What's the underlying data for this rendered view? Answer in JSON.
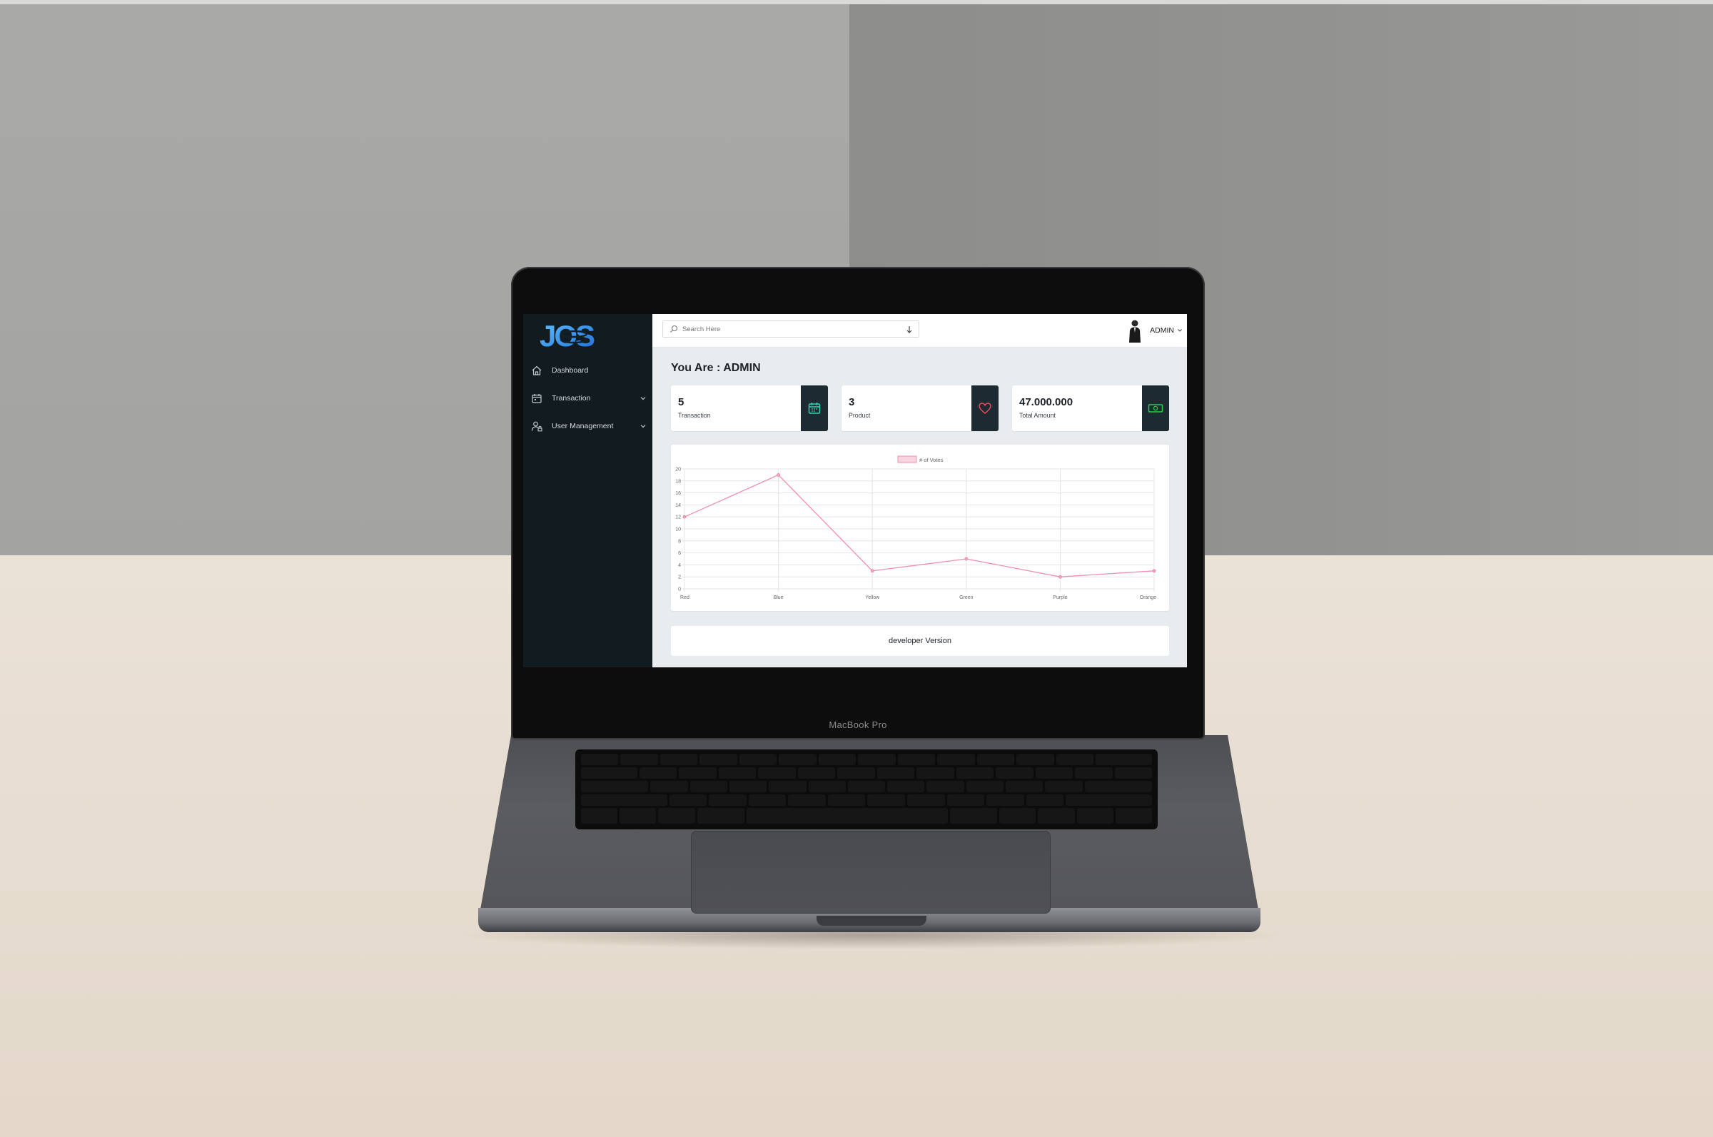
{
  "device": {
    "brand_label": "MacBook Pro"
  },
  "app": {
    "logo_text": "JOS",
    "sidebar": {
      "items": [
        {
          "label": "Dashboard",
          "icon": "home-icon",
          "expandable": false
        },
        {
          "label": "Transaction",
          "icon": "calendar-icon",
          "expandable": true
        },
        {
          "label": "User Management",
          "icon": "user-lock-icon",
          "expandable": true
        }
      ]
    },
    "topbar": {
      "search": {
        "placeholder": "Search Here"
      },
      "user": {
        "name": "ADMIN"
      }
    },
    "main": {
      "heading": "You Are : ADMIN",
      "cards": [
        {
          "value": "5",
          "label": "Transaction",
          "icon": "calendar-icon",
          "icon_color": "#2ed3b7"
        },
        {
          "value": "3",
          "label": "Product",
          "icon": "heart-icon",
          "icon_color": "#ef4a5a"
        },
        {
          "value": "47.000.000",
          "label": "Total Amount",
          "icon": "money-icon",
          "icon_color": "#2cc84a"
        }
      ],
      "footer": "developer Version"
    }
  },
  "chart_data": {
    "type": "line",
    "categories": [
      "Red",
      "Blue",
      "Yellow",
      "Green",
      "Purple",
      "Orange"
    ],
    "series": [
      {
        "name": "# of Votes",
        "values": [
          12,
          19,
          3,
          5,
          2,
          3
        ],
        "color": "#f08fb0"
      }
    ],
    "ylim": [
      0,
      20
    ],
    "yticks": [
      "0",
      "2",
      "4",
      "6",
      "8",
      "10",
      "12",
      "14",
      "16",
      "18",
      "20"
    ],
    "grid": true,
    "legend": "top-center"
  }
}
